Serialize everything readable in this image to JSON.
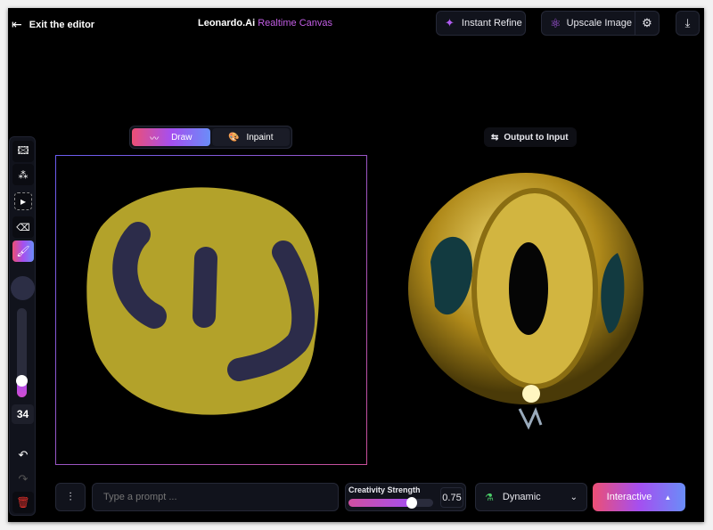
{
  "header": {
    "exit_label": "Exit the editor",
    "brand": "Leonardo.Ai",
    "brand_sub": "Realtime Canvas",
    "instant_refine": "Instant Refine",
    "upscale": "Upscale Image"
  },
  "mode_toggle": {
    "draw": "Draw",
    "inpaint": "Inpaint",
    "active": "Draw"
  },
  "output_to_input": "Output to Input",
  "toolbar": {
    "brush_size": "34",
    "brush_slider_value": 34
  },
  "bottom": {
    "prompt_placeholder": "Type a prompt ...",
    "prompt_value": "",
    "creativity_label": "Creativity Strength",
    "creativity_value": "0.75",
    "creativity_fraction": 0.75,
    "style": "Dynamic",
    "mode_button": "Interactive"
  },
  "colors": {
    "accent_pink": "#ec4f75",
    "accent_purple": "#a54ff0",
    "accent_blue": "#6a8df8",
    "canvas_yellow": "#b3a22a",
    "stroke_navy": "#2c2c4a"
  }
}
